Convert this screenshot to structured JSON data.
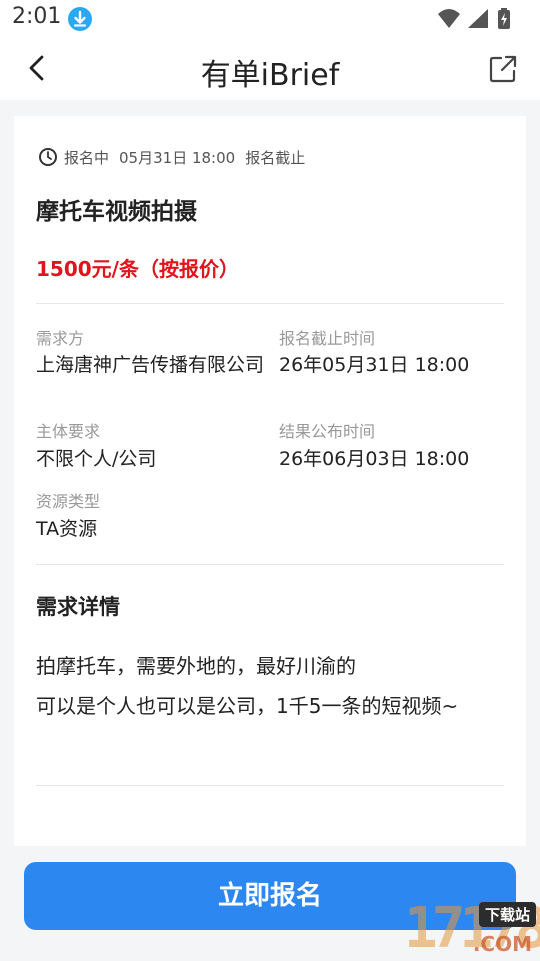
{
  "status_bar": {
    "time": "2:01",
    "icons": [
      "download-icon",
      "wifi-icon",
      "signal-icon",
      "battery-charging-icon"
    ]
  },
  "app_bar": {
    "title": "有单iBrief",
    "back_icon": "chevron-left-icon",
    "share_icon": "share-icon"
  },
  "task": {
    "status": "报名中",
    "deadline_date": "05月31日 18:00",
    "deadline_suffix": "报名截止",
    "title": "摩托车视频拍摄",
    "price": "1500元/条（按报价）"
  },
  "info": {
    "demander_label": "需求方",
    "demander_value": "上海唐神广告传播有限公司",
    "signup_deadline_label": "报名截止时间",
    "signup_deadline_value": "26年05月31日 18:00",
    "subject_label": "主体要求",
    "subject_value": "不限个人/公司",
    "result_label": "结果公布时间",
    "result_value": "26年06月03日 18:00",
    "resource_label": "资源类型",
    "resource_value": "TA资源"
  },
  "detail": {
    "title": "需求详情",
    "line1": "拍摩托车，需要外地的，最好川渝的",
    "line2": "可以是个人也可以是公司，1千5一条的短视频~"
  },
  "footer": {
    "signup_label": "立即报名"
  },
  "watermark": {
    "number": "17178",
    "tag": "下载站",
    "domain": ".COM"
  },
  "colors": {
    "accent": "#2d87f0",
    "price": "#e0141a",
    "muted": "#999999",
    "background": "#f4f5f7"
  }
}
